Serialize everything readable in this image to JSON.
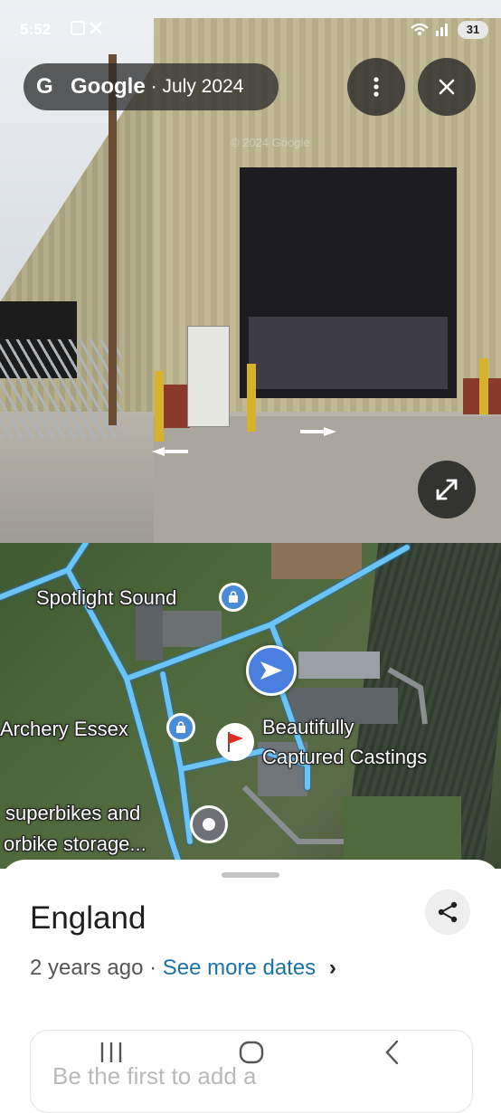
{
  "status_bar": {
    "time": "5:52",
    "battery": "31"
  },
  "streetview": {
    "brand": "Google",
    "date": "· July 2024",
    "watermark": "© 2024 Google"
  },
  "map": {
    "labels": {
      "spotlight": "Spotlight Sound",
      "archery": "Archery Essex",
      "beautifully_line1": "Beautifully",
      "beautifully_line2": "Captured Castings",
      "superbikes_line1": "superbikes and",
      "superbikes_line2": "orbike storage..."
    },
    "colors": {
      "road": "#6cc3f5",
      "pin": "#4a8bd8",
      "flag": "#d93025"
    }
  },
  "sheet": {
    "title": "England",
    "age": "2 years ago ·",
    "see_more": "See more dates",
    "chevron": "›",
    "card_text": "Be the first to add a"
  }
}
